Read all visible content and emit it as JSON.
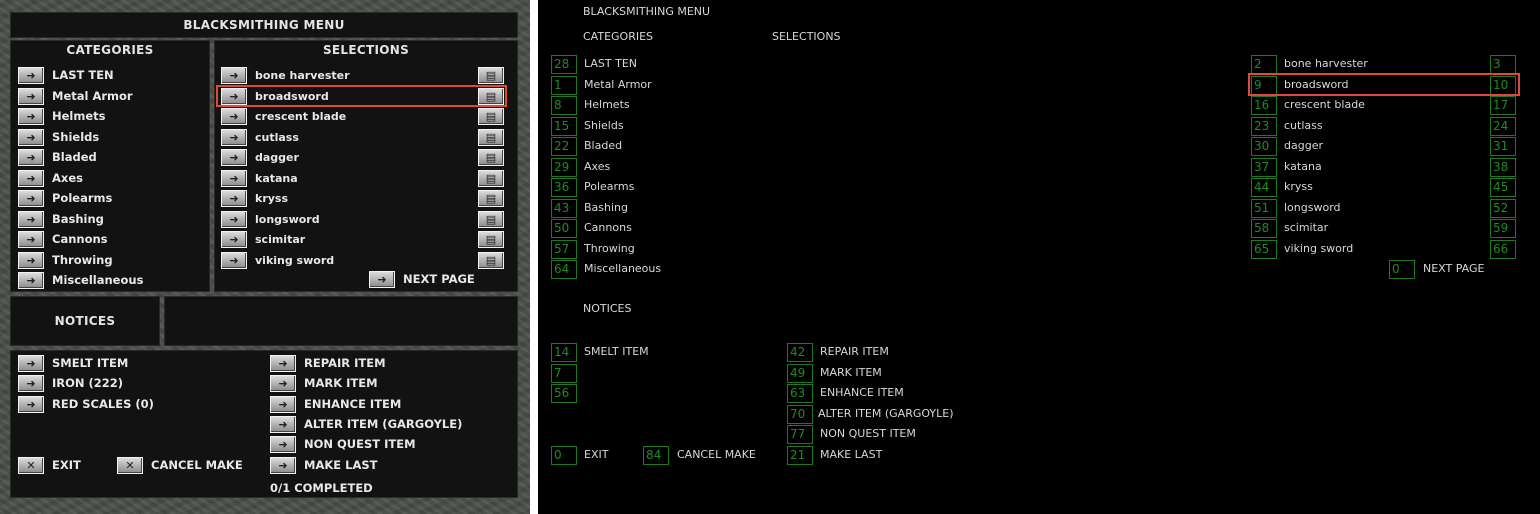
{
  "menu": {
    "title": "BLACKSMITHING MENU",
    "categories_label": "CATEGORIES",
    "selections_label": "SELECTIONS",
    "notices_label": "NOTICES",
    "next_page_label": "NEXT PAGE",
    "completed_text": "0/1 COMPLETED"
  },
  "categories": [
    {
      "label": "LAST TEN",
      "id": "28"
    },
    {
      "label": "Metal Armor",
      "id": "1"
    },
    {
      "label": "Helmets",
      "id": "8"
    },
    {
      "label": "Shields",
      "id": "15"
    },
    {
      "label": "Bladed",
      "id": "22"
    },
    {
      "label": "Axes",
      "id": "29"
    },
    {
      "label": "Polearms",
      "id": "36"
    },
    {
      "label": "Bashing",
      "id": "43"
    },
    {
      "label": "Cannons",
      "id": "50"
    },
    {
      "label": "Throwing",
      "id": "57"
    },
    {
      "label": "Miscellaneous",
      "id": "64"
    }
  ],
  "selections": [
    {
      "label": "bone harvester",
      "id": "2",
      "info_id": "3"
    },
    {
      "label": "broadsword",
      "id": "9",
      "info_id": "10"
    },
    {
      "label": "crescent blade",
      "id": "16",
      "info_id": "17"
    },
    {
      "label": "cutlass",
      "id": "23",
      "info_id": "24"
    },
    {
      "label": "dagger",
      "id": "30",
      "info_id": "31"
    },
    {
      "label": "katana",
      "id": "37",
      "info_id": "38"
    },
    {
      "label": "kryss",
      "id": "44",
      "info_id": "45"
    },
    {
      "label": "longsword",
      "id": "51",
      "info_id": "52"
    },
    {
      "label": "scimitar",
      "id": "58",
      "info_id": "59"
    },
    {
      "label": "viking sword",
      "id": "65",
      "info_id": "66"
    }
  ],
  "next_page_id": "0",
  "left_options": [
    {
      "label": "SMELT ITEM",
      "id": "14"
    },
    {
      "label": "IRON (222)",
      "id": "7"
    },
    {
      "label": "RED SCALES (0)",
      "id": "56"
    }
  ],
  "right_options": [
    {
      "label": "REPAIR ITEM",
      "id": "42"
    },
    {
      "label": "MARK ITEM",
      "id": "49"
    },
    {
      "label": "ENHANCE ITEM",
      "id": "63"
    },
    {
      "label": "ALTER ITEM (GARGOYLE)",
      "id": "70"
    },
    {
      "label": "NON QUEST ITEM",
      "id": "77"
    },
    {
      "label": "MAKE LAST",
      "id": "21"
    }
  ],
  "bottom_actions": [
    {
      "label": "EXIT",
      "id": "0"
    },
    {
      "label": "CANCEL MAKE",
      "id": "84"
    }
  ],
  "colors": {
    "highlight": "#e0483a",
    "id_green": "#1e8b1e"
  }
}
